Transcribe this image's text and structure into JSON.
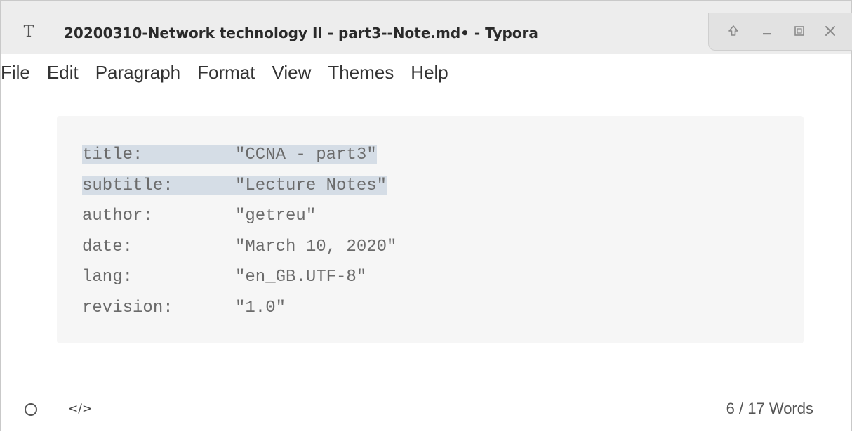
{
  "window": {
    "app_icon": "T",
    "title": "20200310-Network technology II - part3--Note.md• - Typora",
    "controls": [
      "up-arrow-icon",
      "minimize-icon",
      "maximize-icon",
      "close-icon"
    ]
  },
  "menubar": {
    "items": [
      "File",
      "Edit",
      "Paragraph",
      "Format",
      "View",
      "Themes",
      "Help"
    ]
  },
  "front_matter": {
    "lines": [
      {
        "key": "title:",
        "value": "\"CCNA - part3\"",
        "selected": true
      },
      {
        "key": "subtitle:",
        "value": "\"Lecture Notes\"",
        "selected": true
      },
      {
        "key": "author:",
        "value": "\"getreu\"",
        "selected": false
      },
      {
        "key": "date:",
        "value": "\"March 10, 2020\"",
        "selected": false
      },
      {
        "key": "lang:",
        "value": "\"en_GB.UTF-8\"",
        "selected": false
      },
      {
        "key": "revision:",
        "value": "\"1.0\"",
        "selected": false
      }
    ]
  },
  "footer": {
    "source_toggle": "</>",
    "word_count": "6 / 17 Words",
    "icons": [
      "outline-circle-icon",
      "source-code-icon"
    ]
  },
  "colors": {
    "selection": "#d5dde6",
    "code_background": "#f6f6f6",
    "title_bar": "#ededed"
  }
}
